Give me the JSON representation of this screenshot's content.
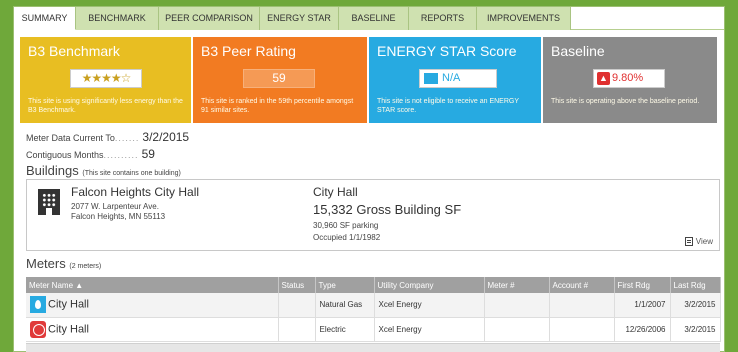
{
  "tabs": [
    "SUMMARY",
    "BENCHMARK",
    "PEER COMPARISON",
    "ENERGY STAR",
    "BASELINE",
    "REPORTS",
    "IMPROVEMENTS"
  ],
  "tiles": {
    "benchmark": {
      "title": "B3 Benchmark",
      "stars": "★★★★☆",
      "rating_fraction": 0.7,
      "desc": "This site is using significantly less energy than the B3 Benchmark.",
      "color": "#e8be22"
    },
    "peer": {
      "title": "B3 Peer Rating",
      "value": "59",
      "desc": "This site is ranked in the 59th percentile amongst 91 similar sites.",
      "color": "#f27b22"
    },
    "energystar": {
      "title": "ENERGY STAR Score",
      "value": "N/A",
      "desc": "This site is not eligible to receive an ENERGY STAR score.",
      "color": "#27aae1"
    },
    "baseline": {
      "title": "Baseline",
      "value": "9.80%",
      "desc": "This site is operating above the baseline period.",
      "color": "#8a8a8a"
    }
  },
  "info": {
    "meter_data_label": "Meter Data Current To",
    "meter_data_value": "3/2/2015",
    "contiguous_label": "Contiguous Months",
    "contiguous_value": "59"
  },
  "buildings": {
    "heading": "Buildings",
    "note": "(This site contains one building)",
    "name": "Falcon Heights City Hall",
    "address1": "2077 W. Larpenteur Ave.",
    "address2": "Falcon Heights, MN 55113",
    "title": "City Hall",
    "sf": "15,332 Gross Building SF",
    "parking": "30,960 SF parking",
    "occupied": "Occupied 1/1/1982",
    "view_label": "View"
  },
  "meters": {
    "heading": "Meters",
    "note": "(2 meters)",
    "columns": [
      "Meter Name ▲",
      "Status",
      "Type",
      "Utility Company",
      "Meter #",
      "Account #",
      "First Rdg",
      "Last Rdg"
    ],
    "rows": [
      {
        "name": "City Hall",
        "icon": "gas-flame-icon",
        "status": "",
        "type": "Natural Gas",
        "utility": "Xcel Energy",
        "meter": "",
        "account": "",
        "first": "1/1/2007",
        "last": "3/2/2015"
      },
      {
        "name": "City Hall",
        "icon": "electric-icon",
        "status": "",
        "type": "Electric",
        "utility": "Xcel Energy",
        "meter": "",
        "account": "",
        "first": "12/26/2006",
        "last": "3/2/2015"
      }
    ]
  }
}
